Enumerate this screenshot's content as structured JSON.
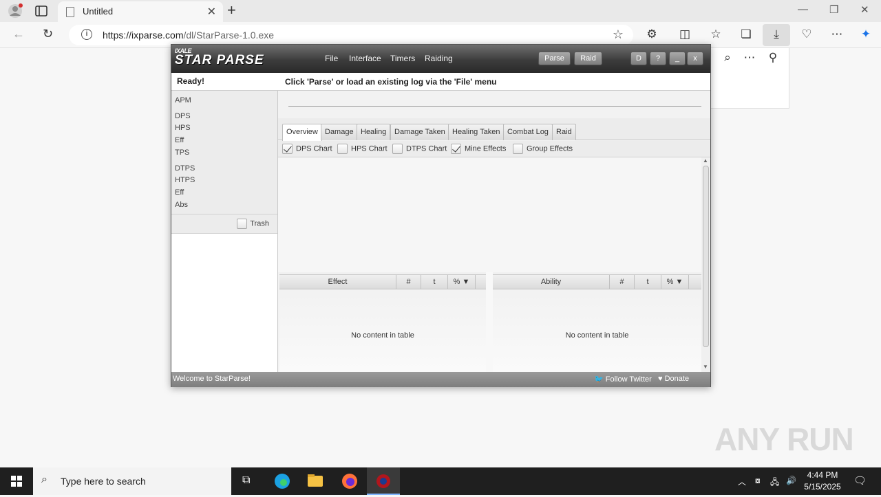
{
  "browser": {
    "tab_title": "Untitled",
    "url_host": "https://ixparse.com",
    "url_path": "/dl/StarParse-1.0.exe"
  },
  "app": {
    "logo_small": "IXALE",
    "logo_big": "STAR PARSE",
    "menu": [
      "File",
      "Interface",
      "Timers",
      "Raiding"
    ],
    "buttons": {
      "parse": "Parse",
      "raid": "Raid"
    },
    "win_buttons": [
      "D",
      "?",
      "_",
      "x"
    ],
    "status": {
      "ready": "Ready!",
      "hint": "Click 'Parse' or load an existing log via the 'File' menu"
    },
    "stats": [
      "APM",
      "DPS",
      "HPS",
      "Eff",
      "TPS",
      "DTPS",
      "HTPS",
      "Eff",
      "Abs"
    ],
    "trash_label": "Trash",
    "tabs": [
      "Overview",
      "Damage",
      "Healing",
      "Damage Taken",
      "Healing Taken",
      "Combat Log",
      "Raid"
    ],
    "active_tab": "Overview",
    "options": [
      {
        "label": "DPS Chart",
        "checked": true
      },
      {
        "label": "HPS Chart",
        "checked": false
      },
      {
        "label": "DTPS Chart",
        "checked": false
      },
      {
        "label": "Mine Effects",
        "checked": true
      },
      {
        "label": "Group Effects",
        "checked": false
      }
    ],
    "effects_table": {
      "columns": [
        "Effect",
        "#",
        "t",
        "% ▼"
      ],
      "empty": "No content in table"
    },
    "ability_table": {
      "columns": [
        "Ability",
        "#",
        "t",
        "% ▼"
      ],
      "empty": "No content in table"
    },
    "footer": {
      "welcome": "Welcome to StarParse!",
      "follow": "Follow Twitter",
      "donate": "Donate"
    }
  },
  "watermark": "ANY RUN",
  "taskbar": {
    "search_placeholder": "Type here to search",
    "time": "4:44 PM",
    "date": "5/15/2025"
  }
}
